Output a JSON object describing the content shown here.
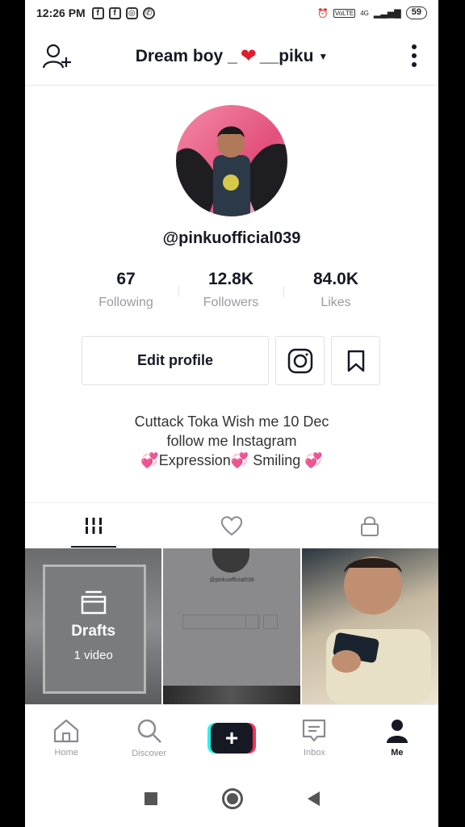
{
  "status_bar": {
    "time": "12:26 PM",
    "network": "4G",
    "battery": "59"
  },
  "header": {
    "title_prefix": "Dream boy _",
    "title_suffix": "__piku"
  },
  "profile": {
    "handle": "@pinkuofficial039",
    "stats": [
      {
        "value": "67",
        "label": "Following"
      },
      {
        "value": "12.8K",
        "label": "Followers"
      },
      {
        "value": "84.0K",
        "label": "Likes"
      }
    ],
    "edit_label": "Edit profile",
    "bio": {
      "line1": "Cuttack Toka Wish me 10 Dec",
      "line2": "follow me Instagram",
      "line3_a": "Expression",
      "line3_b": " Smiling "
    }
  },
  "grid": {
    "drafts_title": "Drafts",
    "drafts_sub": "1 video",
    "mini_handle": "@pinkuofficial039"
  },
  "bottom_nav": [
    {
      "label": "Home",
      "icon": "home-icon"
    },
    {
      "label": "Discover",
      "icon": "search-icon"
    },
    {
      "label": "",
      "icon": "plus-icon"
    },
    {
      "label": "Inbox",
      "icon": "inbox-icon"
    },
    {
      "label": "Me",
      "icon": "person-icon"
    }
  ],
  "colors": {
    "accent_pink": "#fe2c55",
    "accent_cyan": "#25f4ee",
    "text_primary": "#161823",
    "text_secondary": "#9a9ba0"
  }
}
